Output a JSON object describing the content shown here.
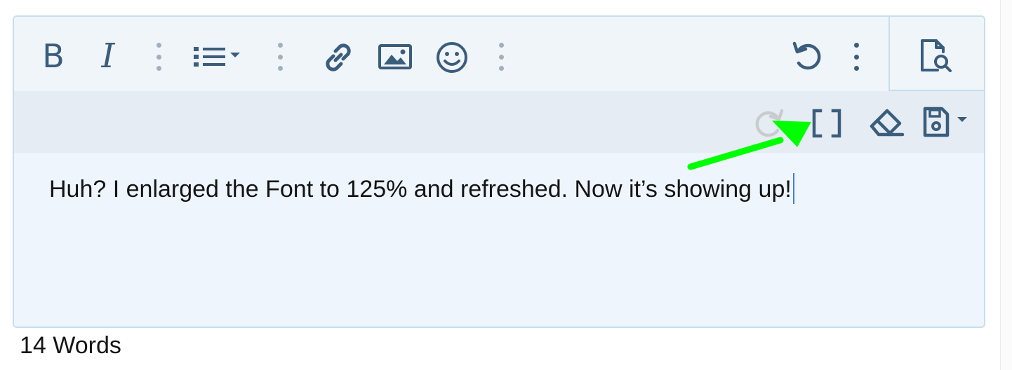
{
  "toolbar": {
    "bold": "B",
    "italic": "I",
    "buttons": {
      "list": "list-icon",
      "link": "link-icon",
      "image": "image-icon",
      "emoji": "smiley-icon",
      "undo": "undo-icon",
      "more": "more-icon",
      "preview": "preview-icon",
      "redo": "redo-icon",
      "bbcode": "brackets-icon",
      "remove_format": "eraser-icon",
      "drafts": "save-icon"
    }
  },
  "editor": {
    "content": "Huh? I enlarged the Font to 125% and refreshed. Now it’s showing up!"
  },
  "footer": {
    "word_count": "14 Words"
  },
  "colors": {
    "icon": "#3b5d7c",
    "icon_disabled": "#c9cccf",
    "toolbar_bg": "#f0f5fa",
    "secondary_toolbar_bg": "#e6ecf3",
    "editor_bg": "#eef5fc",
    "border": "#c4dff0",
    "annotation_arrow": "#00ff00"
  }
}
